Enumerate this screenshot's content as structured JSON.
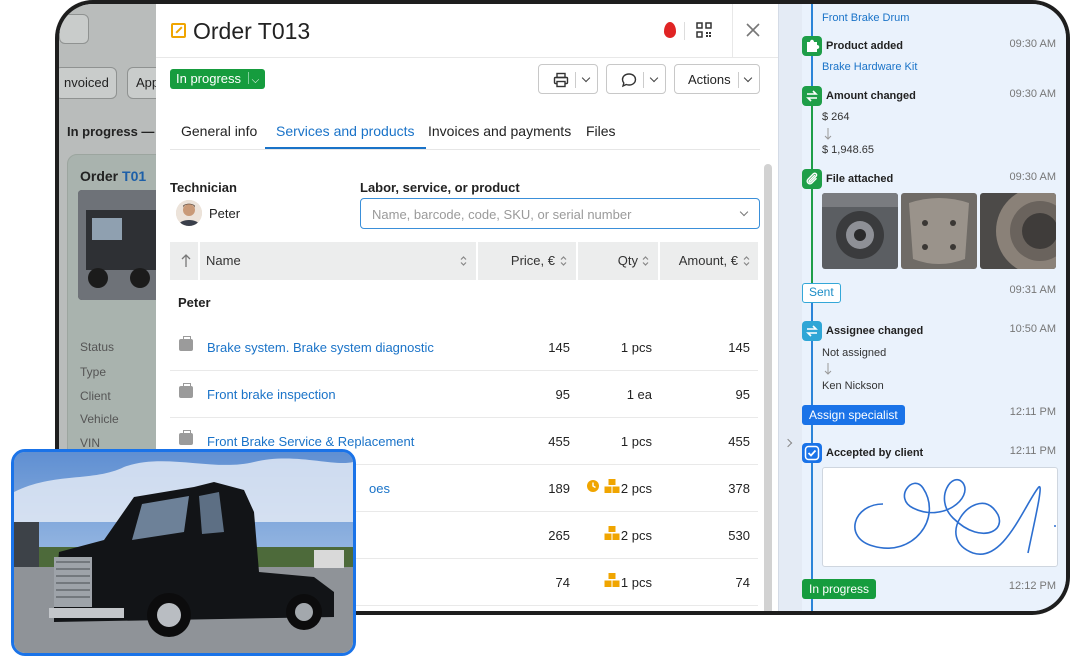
{
  "background": {
    "tab_invoiced": "nvoiced",
    "tab_app": "App",
    "section_label": "In progress —",
    "card_title_prefix": "Order ",
    "card_title_num": "T01",
    "fields": [
      "Status",
      "Type",
      "Client",
      "Vehicle",
      "VIN"
    ]
  },
  "modal": {
    "title": "Order T013",
    "status": "In progress",
    "actions_label": "Actions",
    "tabs": [
      "General info",
      "Services and products",
      "Invoices and payments",
      "Files"
    ],
    "active_tab": "Services and products",
    "technician_label": "Technician",
    "technician_name": "Peter",
    "search_label": "Labor, service, or product",
    "search_placeholder": "Name, barcode, code, SKU, or serial number",
    "table": {
      "columns": [
        "Name",
        "Price, €",
        "Qty",
        "Amount, €"
      ],
      "group": "Peter",
      "rows": [
        {
          "name": "Brake system. Brake system diagnostic",
          "price": "145",
          "qty": "1 pcs",
          "amount": "145",
          "icon": "toolbox-icon"
        },
        {
          "name": "Front brake inspection",
          "price": "95",
          "qty": "1 ea",
          "amount": "95",
          "icon": "toolbox-icon"
        },
        {
          "name": "Front Brake Service & Replacement",
          "price": "455",
          "qty": "1 pcs",
          "amount": "455",
          "icon": "toolbox-icon"
        },
        {
          "name": "oes",
          "price": "189",
          "qty": "2 pcs",
          "amount": "378",
          "icon": "boxes-icon"
        },
        {
          "name": "",
          "price": "265",
          "qty": "2 pcs",
          "amount": "530",
          "icon": "boxes-icon"
        },
        {
          "name": "",
          "price": "74",
          "qty": "1 pcs",
          "amount": "74",
          "icon": "boxes-icon"
        }
      ]
    }
  },
  "timeline": {
    "top_link": "Front Brake Drum",
    "events": {
      "product_added": {
        "title": "Product added",
        "time": "09:30 AM",
        "link": "Brake Hardware Kit"
      },
      "amount_changed": {
        "title": "Amount changed",
        "time": "09:30 AM",
        "from": "$ 264",
        "to": "$ 1,948.65"
      },
      "file_attached": {
        "title": "File attached",
        "time": "09:30 AM"
      },
      "sent": {
        "badge": "Sent",
        "time": "09:31 AM"
      },
      "assignee_changed": {
        "title": "Assignee changed",
        "time": "10:50 AM",
        "from": "Not assigned",
        "to": "Ken Nickson"
      },
      "assign_specialist": {
        "badge": "Assign specialist",
        "time": "12:11 PM"
      },
      "accepted": {
        "title": "Accepted by client",
        "time": "12:11 PM"
      },
      "in_progress": {
        "badge": "In progress",
        "time": "12:12 PM"
      }
    }
  },
  "colors": {
    "accent": "#1a73c8",
    "green": "#169c3e",
    "orange": "#f0a500",
    "timeline_bg": "#eaf2fc"
  }
}
